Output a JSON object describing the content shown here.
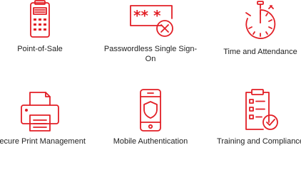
{
  "features": [
    {
      "label": "Point-of-Sale",
      "icon": "pos-terminal-icon"
    },
    {
      "label": "Passwordless Single Sign-On",
      "icon": "password-cancel-icon"
    },
    {
      "label": "Time and Attendance",
      "icon": "stopwatch-icon"
    },
    {
      "label": "Secure Print Management",
      "icon": "printer-icon"
    },
    {
      "label": "Mobile Authentication",
      "icon": "mobile-shield-icon"
    },
    {
      "label": "Training and Compliance",
      "icon": "checklist-clipboard-icon"
    }
  ],
  "accent_color": "#e21f26"
}
